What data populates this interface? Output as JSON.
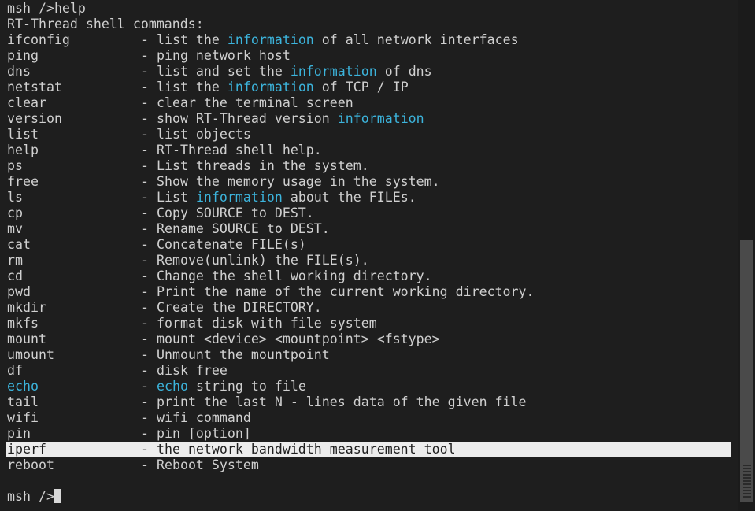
{
  "terminal": {
    "prompt_command": "msh />help",
    "header": "RT-Thread shell commands:",
    "separator": "- ",
    "commands": [
      {
        "cmd": [
          {
            "t": "ifconfig",
            "hl": false
          }
        ],
        "desc": [
          {
            "t": "list the ",
            "hl": false
          },
          {
            "t": "information",
            "hl": true
          },
          {
            "t": " of all network interfaces",
            "hl": false
          }
        ]
      },
      {
        "cmd": [
          {
            "t": "ping",
            "hl": false
          }
        ],
        "desc": [
          {
            "t": "ping network host",
            "hl": false
          }
        ]
      },
      {
        "cmd": [
          {
            "t": "dns",
            "hl": false
          }
        ],
        "desc": [
          {
            "t": "list and set the ",
            "hl": false
          },
          {
            "t": "information",
            "hl": true
          },
          {
            "t": " of dns",
            "hl": false
          }
        ]
      },
      {
        "cmd": [
          {
            "t": "netstat",
            "hl": false
          }
        ],
        "desc": [
          {
            "t": "list the ",
            "hl": false
          },
          {
            "t": "information",
            "hl": true
          },
          {
            "t": " of TCP / IP",
            "hl": false
          }
        ]
      },
      {
        "cmd": [
          {
            "t": "clear",
            "hl": false
          }
        ],
        "desc": [
          {
            "t": "clear the terminal screen",
            "hl": false
          }
        ]
      },
      {
        "cmd": [
          {
            "t": "version",
            "hl": false
          }
        ],
        "desc": [
          {
            "t": "show RT-Thread version ",
            "hl": false
          },
          {
            "t": "information",
            "hl": true
          }
        ]
      },
      {
        "cmd": [
          {
            "t": "list",
            "hl": false
          }
        ],
        "desc": [
          {
            "t": "list objects",
            "hl": false
          }
        ]
      },
      {
        "cmd": [
          {
            "t": "help",
            "hl": false
          }
        ],
        "desc": [
          {
            "t": "RT-Thread shell help.",
            "hl": false
          }
        ]
      },
      {
        "cmd": [
          {
            "t": "ps",
            "hl": false
          }
        ],
        "desc": [
          {
            "t": "List threads in the system.",
            "hl": false
          }
        ]
      },
      {
        "cmd": [
          {
            "t": "free",
            "hl": false
          }
        ],
        "desc": [
          {
            "t": "Show the memory usage in the system.",
            "hl": false
          }
        ]
      },
      {
        "cmd": [
          {
            "t": "ls",
            "hl": false
          }
        ],
        "desc": [
          {
            "t": "List ",
            "hl": false
          },
          {
            "t": "information",
            "hl": true
          },
          {
            "t": " about the FILEs.",
            "hl": false
          }
        ]
      },
      {
        "cmd": [
          {
            "t": "cp",
            "hl": false
          }
        ],
        "desc": [
          {
            "t": "Copy SOURCE to DEST.",
            "hl": false
          }
        ]
      },
      {
        "cmd": [
          {
            "t": "mv",
            "hl": false
          }
        ],
        "desc": [
          {
            "t": "Rename SOURCE to DEST.",
            "hl": false
          }
        ]
      },
      {
        "cmd": [
          {
            "t": "cat",
            "hl": false
          }
        ],
        "desc": [
          {
            "t": "Concatenate FILE(s)",
            "hl": false
          }
        ]
      },
      {
        "cmd": [
          {
            "t": "rm",
            "hl": false
          }
        ],
        "desc": [
          {
            "t": "Remove(unlink) the FILE(s).",
            "hl": false
          }
        ]
      },
      {
        "cmd": [
          {
            "t": "cd",
            "hl": false
          }
        ],
        "desc": [
          {
            "t": "Change the shell working directory.",
            "hl": false
          }
        ]
      },
      {
        "cmd": [
          {
            "t": "pwd",
            "hl": false
          }
        ],
        "desc": [
          {
            "t": "Print the name of the current working directory.",
            "hl": false
          }
        ]
      },
      {
        "cmd": [
          {
            "t": "mkdir",
            "hl": false
          }
        ],
        "desc": [
          {
            "t": "Create the DIRECTORY.",
            "hl": false
          }
        ]
      },
      {
        "cmd": [
          {
            "t": "mkfs",
            "hl": false
          }
        ],
        "desc": [
          {
            "t": "format disk with file system",
            "hl": false
          }
        ]
      },
      {
        "cmd": [
          {
            "t": "mount",
            "hl": false
          }
        ],
        "desc": [
          {
            "t": "mount <device> <mountpoint> <fstype>",
            "hl": false
          }
        ]
      },
      {
        "cmd": [
          {
            "t": "umount",
            "hl": false
          }
        ],
        "desc": [
          {
            "t": "Unmount the mountpoint",
            "hl": false
          }
        ]
      },
      {
        "cmd": [
          {
            "t": "df",
            "hl": false
          }
        ],
        "desc": [
          {
            "t": "disk free",
            "hl": false
          }
        ]
      },
      {
        "cmd": [
          {
            "t": "echo",
            "hl": true
          }
        ],
        "desc": [
          {
            "t": "echo",
            "hl": true
          },
          {
            "t": " string to file",
            "hl": false
          }
        ]
      },
      {
        "cmd": [
          {
            "t": "tail",
            "hl": false
          }
        ],
        "desc": [
          {
            "t": "print the last N - lines data of the given file",
            "hl": false
          }
        ]
      },
      {
        "cmd": [
          {
            "t": "wifi",
            "hl": false
          }
        ],
        "desc": [
          {
            "t": "wifi command",
            "hl": false
          }
        ]
      },
      {
        "cmd": [
          {
            "t": "pin",
            "hl": false
          }
        ],
        "desc": [
          {
            "t": "pin [option]",
            "hl": false
          }
        ]
      },
      {
        "cmd": [
          {
            "t": "iperf",
            "hl": false
          }
        ],
        "desc": [
          {
            "t": "the network bandwidth measurement tool",
            "hl": false
          }
        ],
        "selected": true
      },
      {
        "cmd": [
          {
            "t": "reboot",
            "hl": false
          }
        ],
        "desc": [
          {
            "t": "Reboot System",
            "hl": false
          }
        ]
      }
    ],
    "final_prompt": "msh />"
  },
  "colors": {
    "background": "#1e1e1e",
    "foreground": "#d0d0d0",
    "highlight": "#3cb4dc",
    "selection": "#ececec"
  },
  "icons": {
    "cursor": "block-cursor-icon",
    "scroll_grip": "grip-lines-icon"
  }
}
